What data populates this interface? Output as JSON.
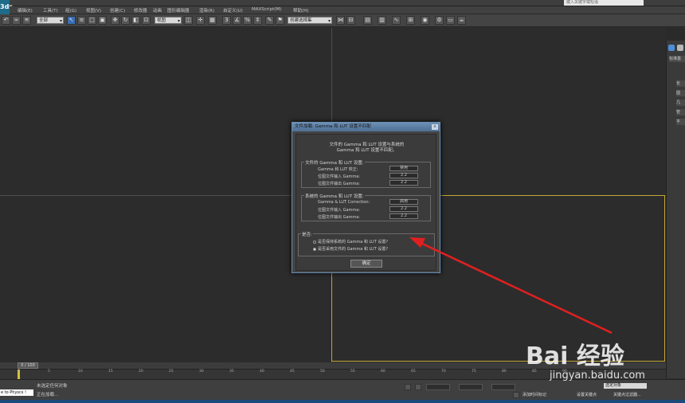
{
  "app": {
    "logo_text": "3ds",
    "search_placeholder": "键入关键字或短语"
  },
  "menu": [
    "编辑(E)",
    "工具(T)",
    "组(G)",
    "视图(V)",
    "创建(C)",
    "修改器",
    "动画",
    "图形编辑器",
    "渲染(R)",
    "自定义(U)",
    "MAXScript(M)",
    "帮助(H)"
  ],
  "toolbar": {
    "filter_select": "全部",
    "view_select": "视图",
    "selection_set": "创建选择集"
  },
  "command_panel": {
    "tab_label": "标准基",
    "items": [
      "长",
      "圆",
      "几",
      "管",
      "平"
    ]
  },
  "dialog": {
    "title": "文件加载: Gamma 和 LUT 设置不匹配",
    "close_label": "x",
    "message_line1": "文件的 Gamma 和 LUT 设置与系统的",
    "message_line2": "Gamma 和 LUT 设置不匹配。",
    "file_group": {
      "title": "文件的 Gamma 和 LUT 设置:",
      "rows": [
        {
          "label": "Gamma 和 LUT 校正:",
          "value": "禁用"
        },
        {
          "label": "位图文件输入 Gamma:",
          "value": "2.2"
        },
        {
          "label": "位图文件输出 Gamma:",
          "value": "2.2"
        }
      ]
    },
    "system_group": {
      "title": "系统的 Gamma 和 LUT 设置:",
      "rows": [
        {
          "label": "Gamma & LUT Correction:",
          "value": "启用"
        },
        {
          "label": "位图文件输入 Gamma:",
          "value": "2.2"
        },
        {
          "label": "位图文件输出 Gamma:",
          "value": "2.2"
        }
      ]
    },
    "prompt_group": {
      "title": "是否:",
      "options": [
        {
          "label": "是否保持系统的 Gamma 和 LUT 设置?",
          "checked": false
        },
        {
          "label": "是否采用文件的 Gamma 和 LUT 设置?",
          "checked": true
        }
      ]
    },
    "ok_label": "确定"
  },
  "timeline": {
    "frame_display": "0 / 100",
    "ticks": [
      "0",
      "5",
      "10",
      "15",
      "20",
      "25",
      "30",
      "35",
      "40",
      "45",
      "50",
      "55",
      "60",
      "65",
      "70",
      "75",
      "80",
      "85",
      "90"
    ]
  },
  "status": {
    "line1": "未选定任何对象",
    "line2": "正在加载...",
    "listener_text": "e to Physcs !",
    "add_time_tag": "添加时间标记",
    "set_key": "设置关键点",
    "key_filter": "关键点过滤器...",
    "selected_object": "选定对象"
  },
  "watermark": {
    "logo": "Bai 经验",
    "url": "jingyan.baidu.com"
  },
  "colors": {
    "active_viewport_border": "#c4a538",
    "arrow": "#e02020",
    "dialog_title": "#5d7fa4"
  }
}
